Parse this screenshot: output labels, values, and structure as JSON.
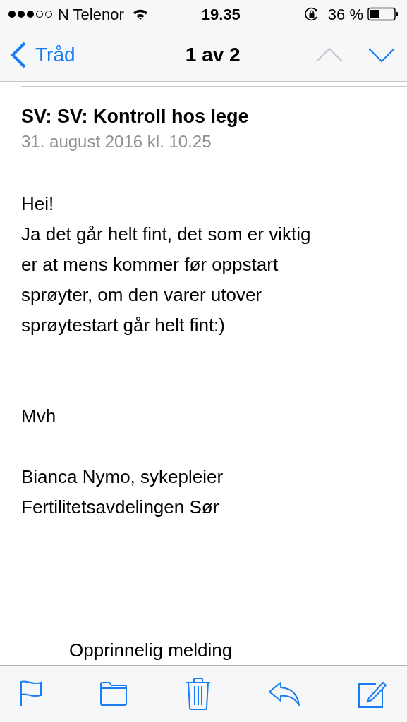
{
  "status_bar": {
    "carrier": "N Telenor",
    "time": "19.35",
    "battery": "36 %"
  },
  "nav_bar": {
    "back": "Tråd",
    "title": "1 av 2",
    "previous_disabled": true,
    "next_disabled": false
  },
  "message": {
    "subject": "SV: SV: Kontroll hos lege",
    "date": "31. august 2016 kl. 10.25",
    "paragraphs": [
      {
        "kind": "text",
        "lines": [
          "Hei!",
          "Ja det går helt fint, det som er viktig",
          "er at mens kommer før oppstart",
          "sprøyter, om den varer utover",
          "sprøytestart går helt fint:)"
        ]
      },
      {
        "kind": "text",
        "lines": [
          "Mvh"
        ]
      },
      {
        "kind": "text",
        "lines": [
          "Bianca Nymo, sykepleier",
          "Fertilitetsavdelingen Sør"
        ]
      },
      {
        "kind": "quote_header",
        "lines": [
          "Opprinnelig melding"
        ]
      }
    ]
  }
}
